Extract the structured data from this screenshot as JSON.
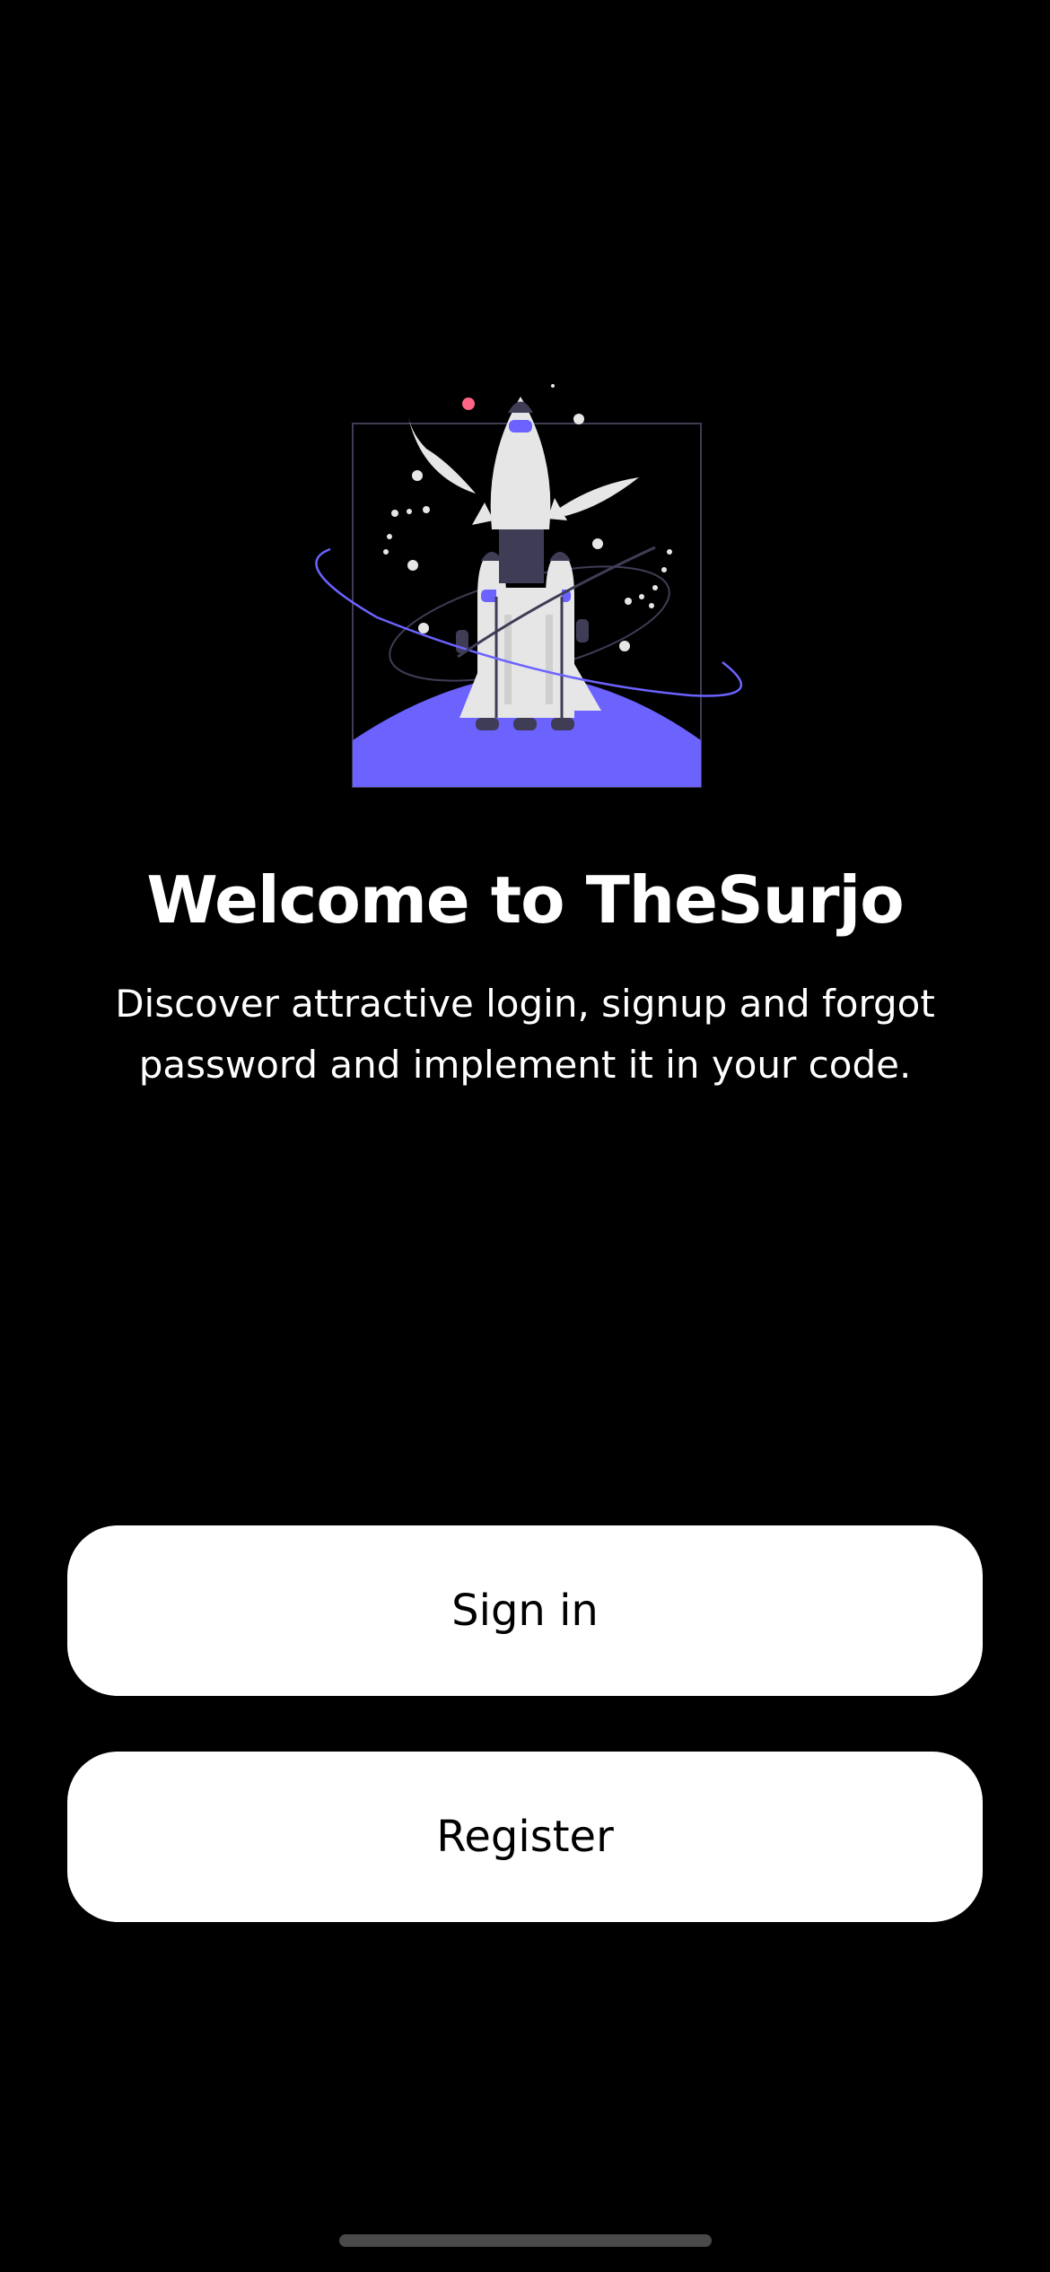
{
  "welcome": {
    "title": "Welcome to TheSurjo",
    "subtitle": "Discover attractive login, signup and forgot password and implement it in your code."
  },
  "actions": {
    "sign_in_label": "Sign in",
    "register_label": "Register"
  },
  "illustration": {
    "name": "rocket-launch-illustration",
    "accent_color": "#6c63ff",
    "planet_color": "#6c63ff",
    "rocket_color": "#e6e6e6",
    "dark_color": "#3f3d56",
    "dot_color": "#ff6584"
  },
  "theme": {
    "background": "#000000",
    "button_background": "#ffffff",
    "button_text": "#000000",
    "text": "#ffffff"
  }
}
